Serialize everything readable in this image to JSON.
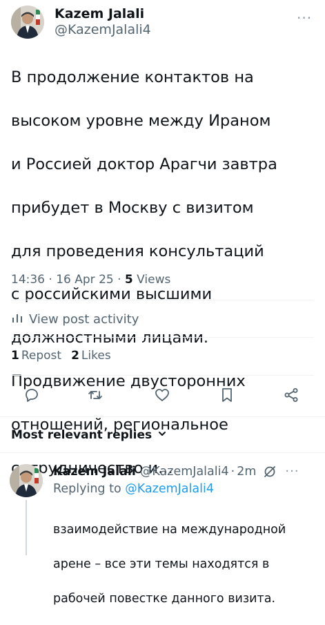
{
  "tweet": {
    "author_name": "Kazem Jalali",
    "author_handle": "@KazemJalali4",
    "text_lines": [
      "В продолжение контактов на",
      "высоком уровне между Ираном",
      "и Россией доктор Арагчи завтра",
      "прибудет в Москву с визитом",
      "для проведения консультаций",
      "с российскими высшими",
      "должностными лицами.",
      "Продвижение двусторонних",
      "отношений, региональное",
      "сотрудничество и..."
    ],
    "time": "14:36",
    "date": "16 Apr 25",
    "views_count": "5",
    "views_label": "Views",
    "separator": "·"
  },
  "activity": {
    "label": "View post activity",
    "icon": "bar-chart-icon"
  },
  "stats": {
    "reposts_count": "1",
    "reposts_label": "Repost",
    "likes_count": "2",
    "likes_label": "Likes"
  },
  "actions": {
    "icons": [
      "reply-icon",
      "repost-icon",
      "like-icon",
      "bookmark-icon",
      "share-icon"
    ]
  },
  "replies_section": {
    "title": "Most relevant replies",
    "icon": "chevron-down-icon"
  },
  "reply": {
    "author_name": "Kazem Jalali",
    "author_handle": "@KazemJalali4",
    "separator": "·",
    "time": "2m",
    "replying_prefix": "Replying to",
    "replying_to": "@KazemJalali4",
    "text_lines": [
      "взаимодействие на международной",
      "арене – все эти темы находятся в",
      "рабочей повестке данного визита."
    ]
  },
  "colors": {
    "text": "#0f1419",
    "secondary": "#536471",
    "link": "#1d9bf0",
    "divider": "#eff3f4"
  }
}
